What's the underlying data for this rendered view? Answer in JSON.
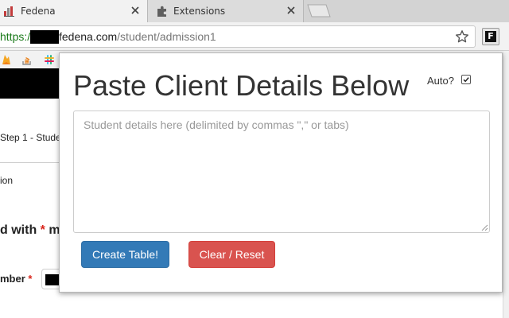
{
  "tabs": [
    {
      "title": "Fedena",
      "favicon": "fedena-favicon-icon",
      "active": true
    },
    {
      "title": "Extensions",
      "favicon": "puzzle-piece-icon",
      "active": false
    }
  ],
  "omnibox": {
    "scheme": "https://",
    "host": "fedena.com",
    "path": "/student/admission1"
  },
  "background_page": {
    "step_text": "Step 1 - Stude",
    "section_text": "ion",
    "required_text": "d with ",
    "required_star": "*",
    "required_tail": " m",
    "number_label": "mber",
    "number_star": "*"
  },
  "popup": {
    "title": "Paste Client Details Below",
    "auto_label": "Auto?",
    "auto_checked": true,
    "textarea_value": "",
    "textarea_placeholder": "Student details here (delimited by commas \",\" or tabs)",
    "create_button": "Create Table!",
    "clear_button": "Clear / Reset"
  },
  "colors": {
    "primary_button": "#337ab7",
    "danger_button": "#d9534f",
    "secure_scheme": "#1a7a1a",
    "required_star": "#d9261c"
  }
}
